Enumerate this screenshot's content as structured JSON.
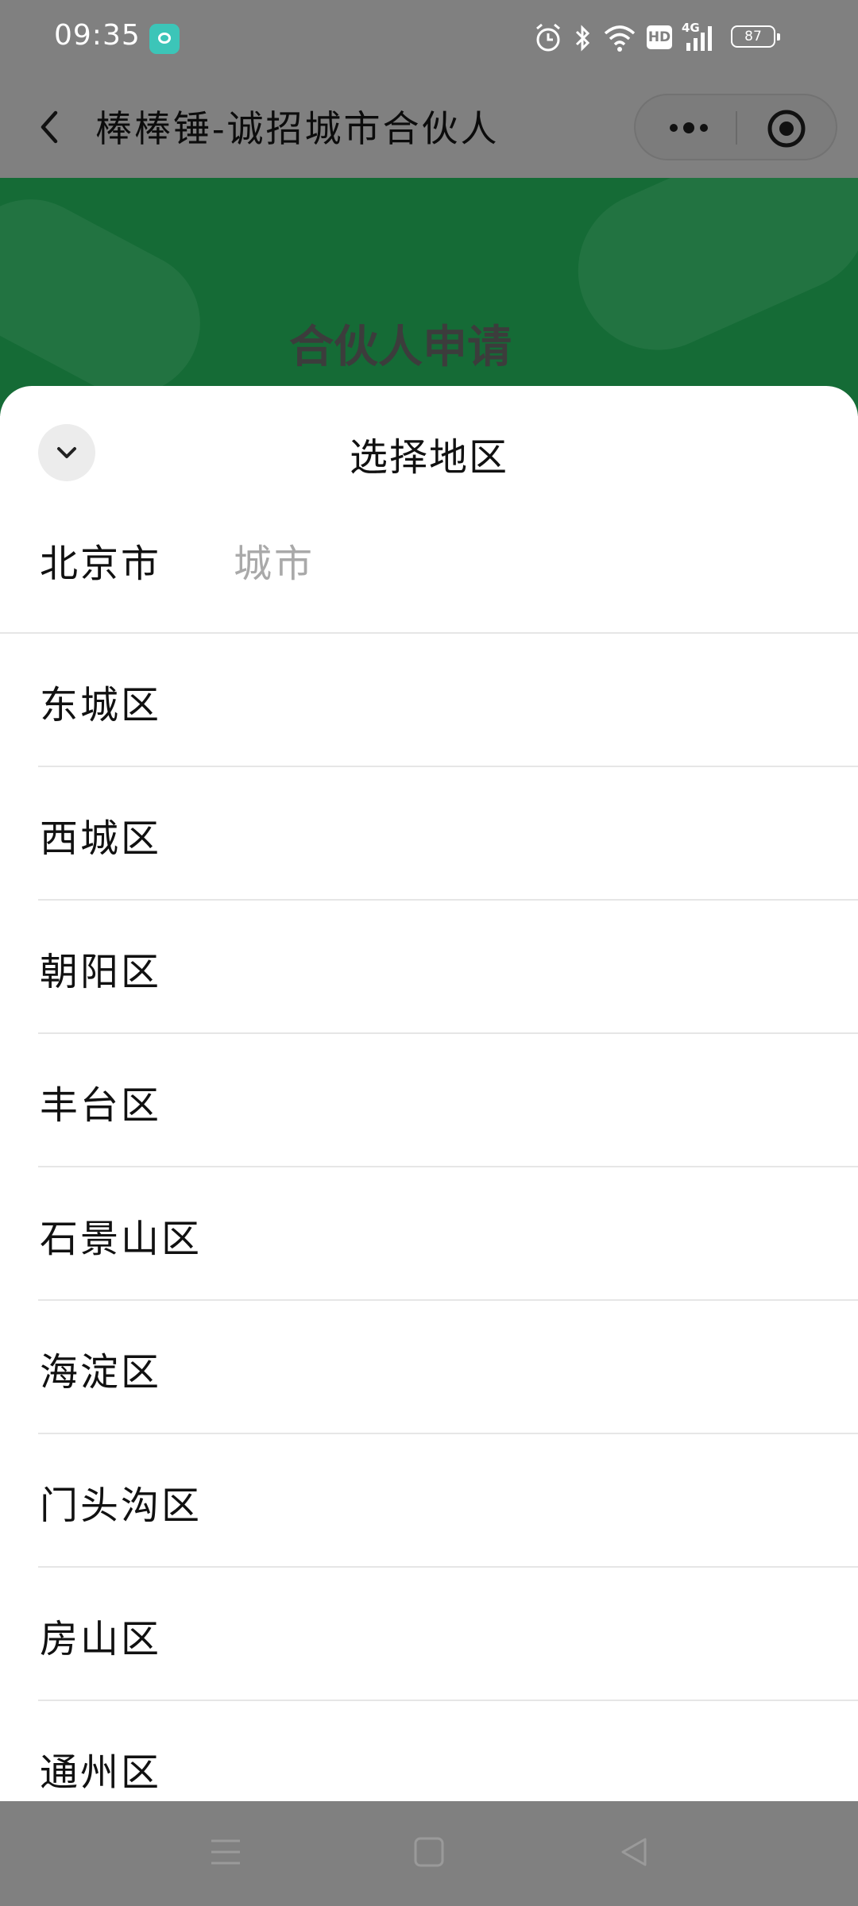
{
  "status_bar": {
    "time": "09:35",
    "battery": "87",
    "network": "4G",
    "hd": "HD"
  },
  "title_bar": {
    "title": "棒棒锤-诚招城市合伙人"
  },
  "hero": {
    "title": "合伙人申请"
  },
  "sheet": {
    "title": "选择地区",
    "tabs": {
      "province": "北京市",
      "city": "城市"
    },
    "districts": [
      {
        "label": "东城区"
      },
      {
        "label": "西城区"
      },
      {
        "label": "朝阳区"
      },
      {
        "label": "丰台区"
      },
      {
        "label": "石景山区"
      },
      {
        "label": "海淀区"
      },
      {
        "label": "门头沟区"
      },
      {
        "label": "房山区"
      },
      {
        "label": "通州区"
      }
    ]
  },
  "colors": {
    "hero_green": "#156b36",
    "overlay_gray": "#808080",
    "placeholder_gray": "#a9a9a9"
  }
}
